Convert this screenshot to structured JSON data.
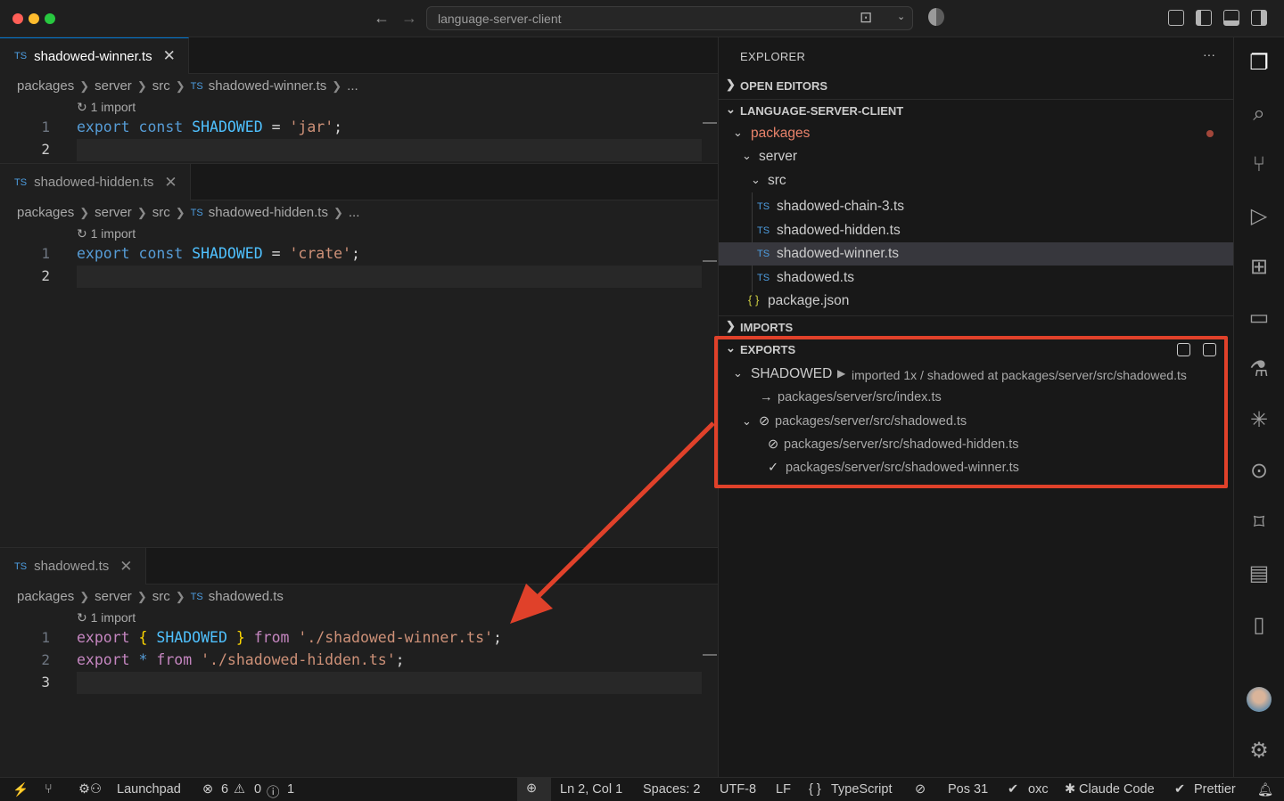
{
  "titlebar": {
    "search_text": "language-server-client"
  },
  "editors": [
    {
      "tab": {
        "badge": "TS",
        "label": "shadowed-winner.ts",
        "close": "✕"
      },
      "breadcrumb": [
        "packages",
        "server",
        "src",
        "shadowed-winner.ts",
        "..."
      ],
      "codelens": "↻ 1 import",
      "lines": [
        {
          "num": "1"
        },
        {
          "num": "2"
        }
      ]
    },
    {
      "tab": {
        "badge": "TS",
        "label": "shadowed-hidden.ts",
        "close": "✕"
      },
      "breadcrumb": [
        "packages",
        "server",
        "src",
        "shadowed-hidden.ts",
        "..."
      ],
      "codelens": "↻ 1 import",
      "lines": [
        {
          "num": "1"
        },
        {
          "num": "2"
        }
      ]
    },
    {
      "tab": {
        "badge": "TS",
        "label": "shadowed.ts",
        "close": "✕"
      },
      "breadcrumb": [
        "packages",
        "server",
        "src",
        "shadowed.ts"
      ],
      "codelens": "↻ 1 import",
      "lines": [
        {
          "num": "1"
        },
        {
          "num": "2"
        },
        {
          "num": "3"
        }
      ]
    }
  ],
  "code": {
    "export": "export",
    "const": "const",
    "shadowed_id": "SHADOWED",
    "eq": "=",
    "jar": "'jar'",
    "crate": "'crate'",
    "semi": ";",
    "lbrace": "{",
    "rbrace": "}",
    "from": "from",
    "star": "*",
    "winner_path": "'./shadowed-winner.ts'",
    "hidden_path": "'./shadowed-hidden.ts'"
  },
  "explorer": {
    "title": "EXPLORER",
    "more": "···",
    "open_editors": "OPEN EDITORS",
    "root": "LANGUAGE-SERVER-CLIENT",
    "folders": {
      "packages": "packages",
      "server": "server",
      "src": "src"
    },
    "files": [
      {
        "badge": "TS",
        "name": "shadowed-chain-3.ts"
      },
      {
        "badge": "TS",
        "name": "shadowed-hidden.ts"
      },
      {
        "badge": "TS",
        "name": "shadowed-winner.ts"
      },
      {
        "badge": "TS",
        "name": "shadowed.ts"
      }
    ],
    "package_json": {
      "icon": "{ }",
      "name": "package.json"
    },
    "imports": "IMPORTS",
    "exports": {
      "header": "EXPORTS",
      "symbol": "SHADOWED",
      "detail": "imported 1x / shadowed at packages/server/src/shadowed.ts",
      "rows": [
        {
          "icon": "→",
          "path": "packages/server/src/index.ts"
        },
        {
          "icon": "⊘",
          "path": "packages/server/src/shadowed.ts"
        },
        {
          "icon": "⊘",
          "path": "packages/server/src/shadowed-hidden.ts"
        },
        {
          "icon": "✓",
          "path": "packages/server/src/shadowed-winner.ts"
        }
      ]
    }
  },
  "statusbar": {
    "launchpad": "Launchpad",
    "errors": "6",
    "warnings": "0",
    "infos": "1",
    "position": "Ln 2, Col 1",
    "spaces": "Spaces: 2",
    "encoding": "UTF-8",
    "eol": "LF",
    "language": "TypeScript",
    "pos": "Pos 31",
    "oxc": "oxc",
    "claude": "Claude Code",
    "prettier": "Prettier"
  },
  "colors": {
    "accent": "#0078d4",
    "highlight_box": "#e0412a",
    "folder_modified": "#e8826a"
  }
}
